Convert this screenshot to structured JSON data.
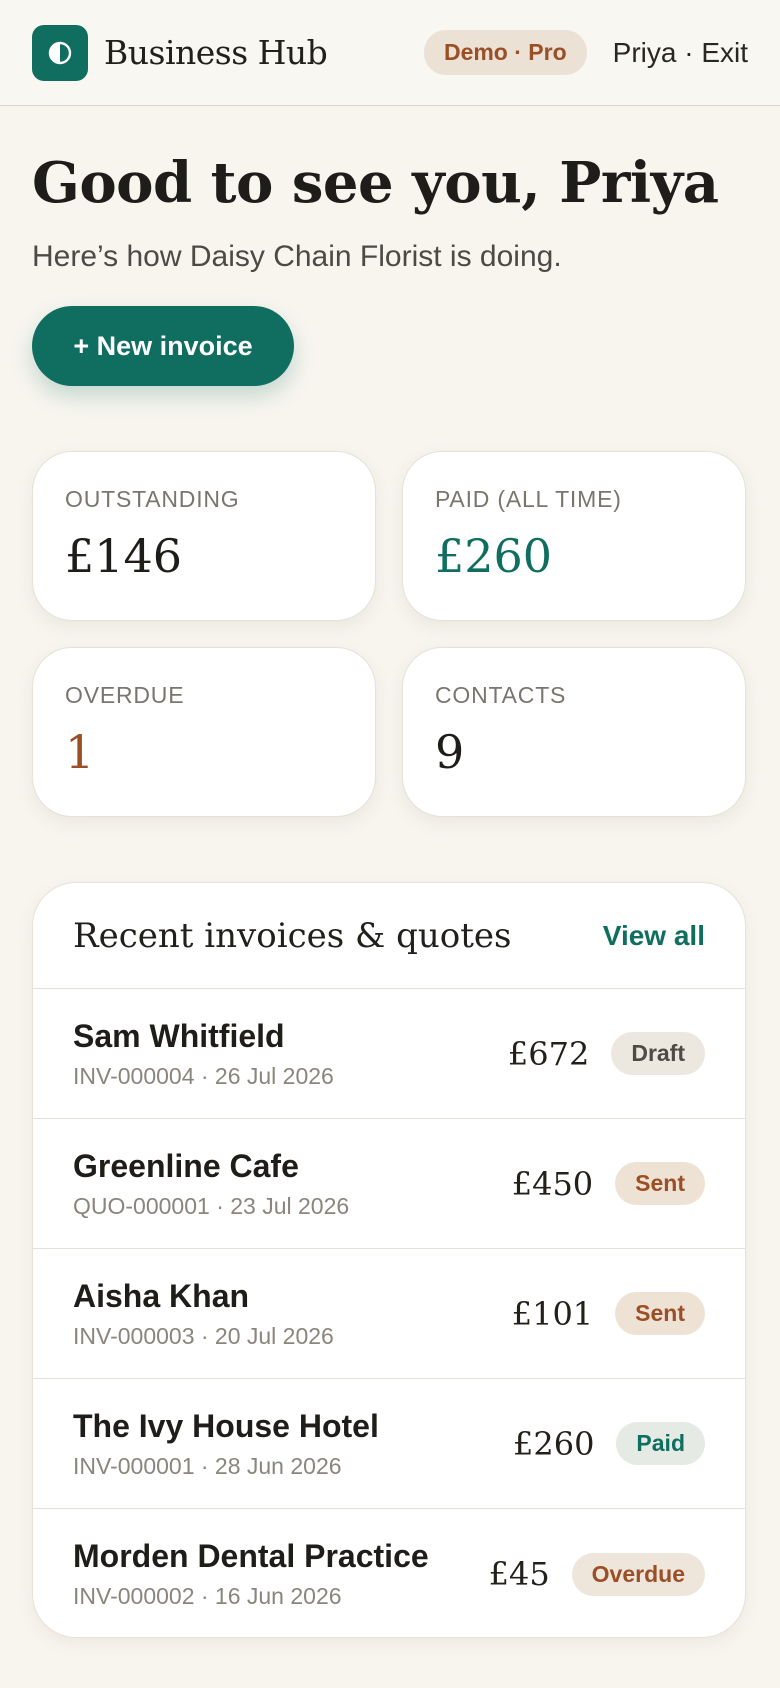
{
  "header": {
    "brand": "Business Hub",
    "plan_badge": "Demo · Pro",
    "user_exit": "Priya · Exit"
  },
  "hero": {
    "greeting": "Good to see you, Priya",
    "subtitle": "Here’s how Daisy Chain Florist is doing.",
    "new_invoice_label": "+ New invoice"
  },
  "stats": [
    {
      "label": "OUTSTANDING",
      "value": "£146"
    },
    {
      "label": "PAID (ALL TIME)",
      "value": "£260"
    },
    {
      "label": "OVERDUE",
      "value": "1"
    },
    {
      "label": "CONTACTS",
      "value": "9"
    }
  ],
  "recent": {
    "title": "Recent invoices & quotes",
    "view_all": "View all",
    "rows": [
      {
        "name": "Sam Whitfield",
        "meta": "INV-000004 · 26 Jul 2026",
        "amount": "£672",
        "status": "Draft"
      },
      {
        "name": "Greenline Cafe",
        "meta": "QUO-000001 · 23 Jul 2026",
        "amount": "£450",
        "status": "Sent"
      },
      {
        "name": "Aisha Khan",
        "meta": "INV-000003 · 20 Jul 2026",
        "amount": "£101",
        "status": "Sent"
      },
      {
        "name": "The Ivy House Hotel",
        "meta": "INV-000001 · 28 Jun 2026",
        "amount": "£260",
        "status": "Paid"
      },
      {
        "name": "Morden Dental Practice",
        "meta": "INV-000002 · 16 Jun 2026",
        "amount": "£45",
        "status": "Overdue"
      }
    ]
  },
  "colors": {
    "brand": "#0f6e60",
    "accent_rust": "#9b4f26",
    "background": "#f8f5ef"
  },
  "icons": {
    "logo": "half-circle-logo-icon"
  }
}
